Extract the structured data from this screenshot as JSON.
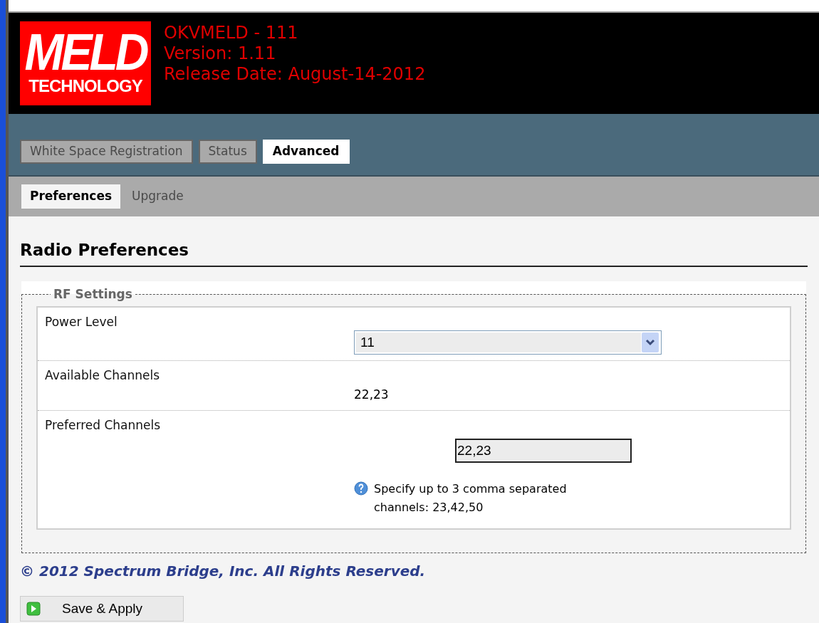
{
  "logo": {
    "line1": "MELD",
    "line2": "TECHNOLOGY"
  },
  "header": {
    "lines": [
      "OKVMELD - 111",
      "Version: 1.11",
      "Release Date: August-14-2012"
    ]
  },
  "tabs": [
    {
      "label": "White Space Registration",
      "selected": false
    },
    {
      "label": "Status",
      "selected": false
    },
    {
      "label": "Advanced",
      "selected": true
    }
  ],
  "subtabs": [
    {
      "label": "Preferences",
      "selected": true
    },
    {
      "label": "Upgrade",
      "selected": false
    }
  ],
  "page_title": "Radio Preferences",
  "fieldset": {
    "legend": "RF Settings",
    "rows": [
      {
        "kind": "select",
        "label": "Power Level",
        "value": "11"
      },
      {
        "kind": "text",
        "label": "Available Channels",
        "value": "22,23"
      },
      {
        "kind": "input",
        "label": "Preferred Channels",
        "value": "22,23",
        "hint": "Specify up to 3 comma separated channels: 23,42,50"
      }
    ]
  },
  "footer": "© 2012 Spectrum Bridge, Inc. All Rights Reserved.",
  "save_button": "Save & Apply"
}
